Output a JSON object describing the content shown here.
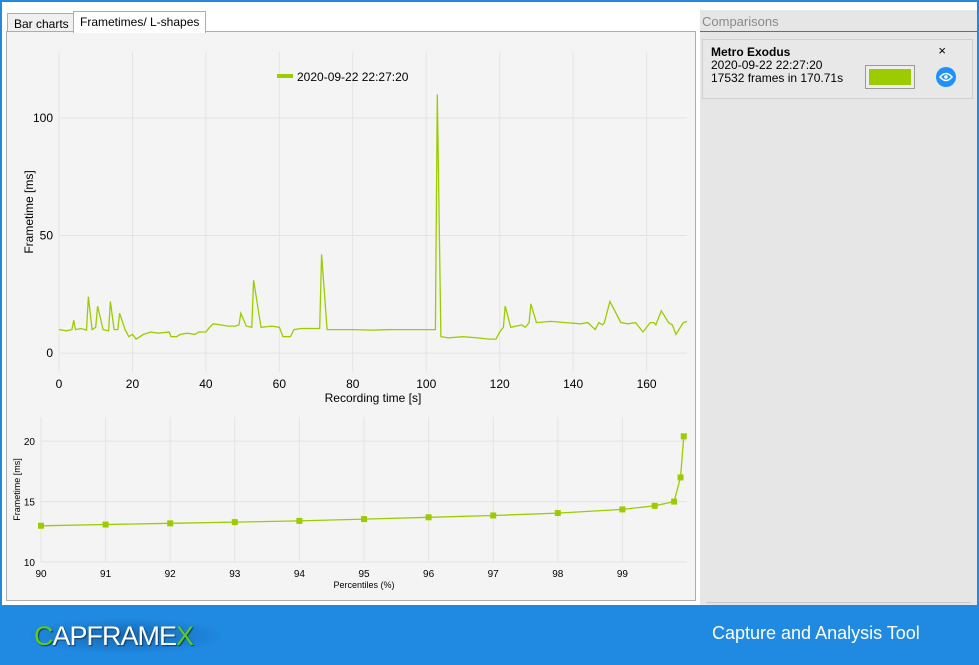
{
  "tabs": [
    {
      "label": "Bar charts"
    },
    {
      "label": "Frametimes/ L-shapes"
    }
  ],
  "colors": {
    "series": "#9ccc00",
    "accent": "#2089e2"
  },
  "comparisons": {
    "title": "Comparisons",
    "item": {
      "game": "Metro Exodus",
      "date": "2020-09-22 22:27:20",
      "frames": "17532 frames in 170.71s",
      "close": "×",
      "icon": "eye-icon"
    }
  },
  "footer": {
    "logo_c": "C",
    "logo_mid": "APFRAME",
    "logo_x": "X",
    "tagline": "Capture and Analysis Tool"
  },
  "chart_data": [
    {
      "type": "line",
      "legend": "2020-09-22 22:27:20",
      "xlabel": "Recording time [s]",
      "ylabel": "Frametime [ms]",
      "xlim": [
        0,
        171
      ],
      "ylim": [
        -8,
        128
      ],
      "xticks": [
        0,
        20,
        40,
        60,
        80,
        100,
        120,
        140,
        160
      ],
      "yticks": [
        0,
        50,
        100
      ],
      "x": [
        0,
        2,
        3.5,
        4,
        4.5,
        6,
        7.5,
        8,
        9,
        10,
        10.5,
        12,
        13.5,
        14,
        15,
        16,
        16.5,
        18,
        19,
        20,
        21,
        23,
        25,
        27,
        30,
        30.5,
        32,
        33,
        35,
        37,
        38,
        40,
        41,
        42,
        44,
        46,
        48,
        49,
        49.5,
        51,
        52.5,
        53,
        55,
        58,
        60,
        61,
        63,
        64,
        66,
        68,
        70,
        71,
        71.5,
        73,
        76,
        80,
        85,
        90,
        95,
        100,
        102,
        102.5,
        103,
        104,
        106,
        110,
        114,
        117,
        118,
        119,
        120,
        121,
        121.5,
        123,
        126,
        127,
        128,
        128.5,
        130,
        134,
        138,
        142,
        144,
        146,
        147,
        148,
        148.5,
        150,
        153,
        155,
        157,
        159,
        161,
        162,
        162.5,
        164,
        166,
        167,
        168,
        170,
        171
      ],
      "y": [
        10,
        9.5,
        10,
        14,
        10,
        10.5,
        9.8,
        24,
        10,
        11,
        20,
        10,
        9.5,
        22,
        10,
        10,
        17,
        10,
        7,
        8,
        6,
        8,
        9,
        8.5,
        9,
        7,
        7,
        8,
        8.5,
        8,
        9,
        9,
        11,
        12.5,
        12,
        11.5,
        11.5,
        12,
        17,
        11.5,
        11,
        31,
        11,
        11.5,
        11,
        7,
        7,
        10,
        10.5,
        10.5,
        10.5,
        10.5,
        42,
        10,
        10,
        10,
        9.8,
        10,
        10,
        10,
        10,
        10,
        110,
        7,
        6.5,
        7,
        6.5,
        6,
        6,
        6,
        9,
        11,
        20,
        11,
        12,
        11,
        13,
        21,
        13,
        13.5,
        13,
        12.5,
        13,
        10,
        13,
        12,
        13,
        22,
        13,
        12.5,
        13,
        9,
        13,
        13,
        12,
        18,
        13,
        12,
        8,
        13,
        13.5,
        13
      ]
    },
    {
      "type": "line",
      "xlabel": "Percentiles (%)",
      "ylabel": "Frametime [ms]",
      "xlim": [
        90,
        100
      ],
      "ylim": [
        10,
        22
      ],
      "xticks": [
        90,
        91,
        92,
        93,
        94,
        95,
        96,
        97,
        98,
        99
      ],
      "yticks": [
        10,
        15,
        20
      ],
      "x": [
        90,
        91,
        92,
        93,
        94,
        95,
        96,
        97,
        98,
        99,
        99.5,
        99.8,
        99.9,
        99.95
      ],
      "y": [
        13.0,
        13.1,
        13.2,
        13.3,
        13.4,
        13.55,
        13.7,
        13.85,
        14.05,
        14.35,
        14.65,
        15.0,
        17.0,
        20.4
      ]
    }
  ]
}
